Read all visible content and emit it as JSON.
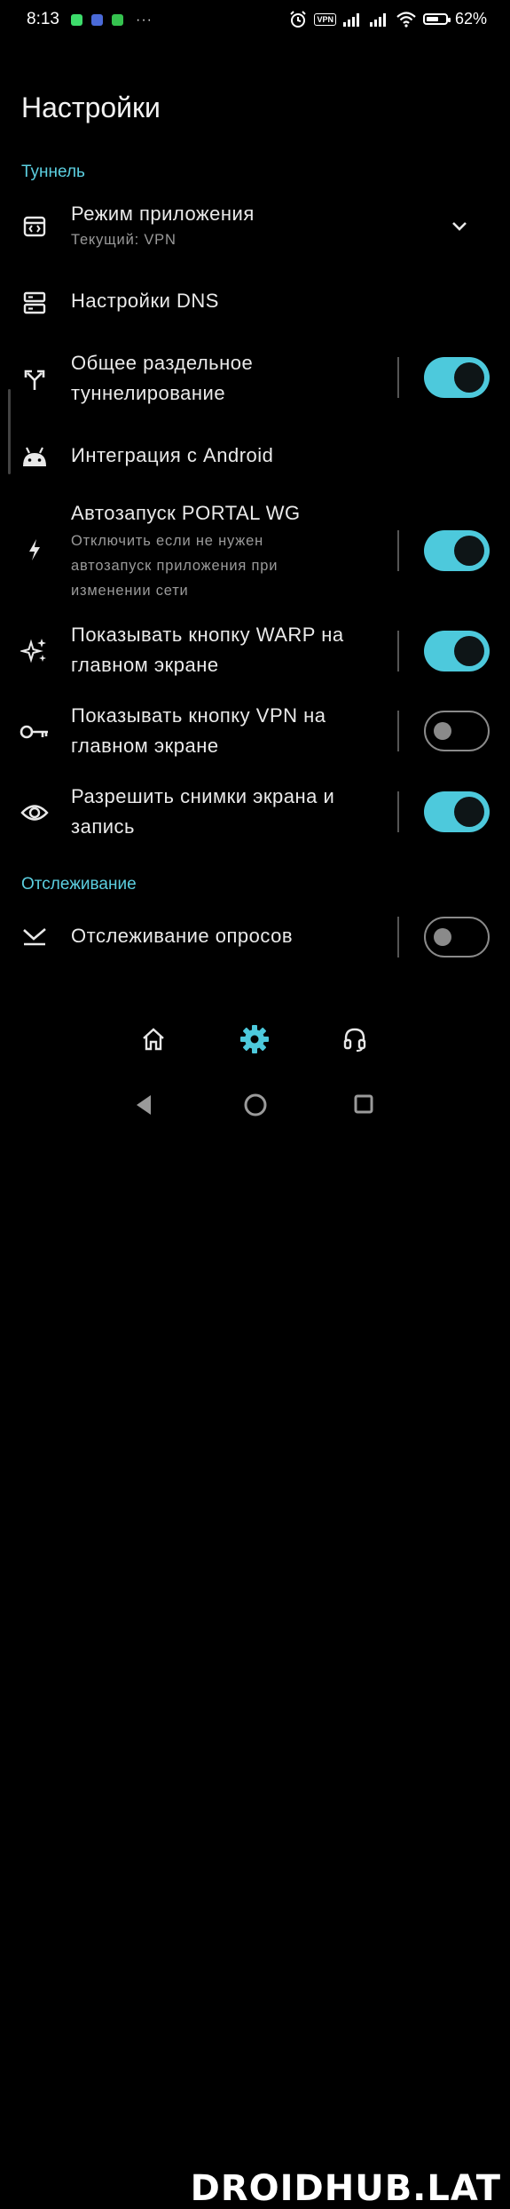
{
  "status_bar": {
    "time": "8:13",
    "vpn_label": "VPN",
    "battery": "62%",
    "battery_level": 0.62
  },
  "page_title": "Настройки",
  "sections": {
    "tunnel": "Туннель",
    "tracking": "Отслеживание"
  },
  "settings": {
    "app_mode": {
      "title": "Режим приложения",
      "subtitle": "Текущий: VPN",
      "icon": "app-window-icon"
    },
    "dns": {
      "title": "Настройки DNS",
      "icon": "dns-server-icon"
    },
    "split_tunnel": {
      "title": "Общее раздельное туннелирование",
      "enabled": true,
      "icon": "split-arrow-icon"
    },
    "android_integration": {
      "title": "Интеграция с Android",
      "icon": "android-icon"
    },
    "autostart": {
      "title": "Автозапуск PORTAL WG",
      "subtitle": "Отключить если не нужен автозапуск приложения при изменении сети",
      "enabled": true,
      "icon": "lightning-icon"
    },
    "warp_button": {
      "title": "Показывать кнопку WARP на главном экране",
      "enabled": true,
      "icon": "sparkles-icon"
    },
    "vpn_button": {
      "title": "Показывать кнопку VPN на главном экране",
      "enabled": false,
      "icon": "key-icon"
    },
    "screenshots": {
      "title": "Разрешить снимки экрана и запись",
      "enabled": true,
      "icon": "eye-icon"
    },
    "poll_tracking": {
      "title": "Отслеживание опросов",
      "enabled": false,
      "icon": "poll-icon"
    }
  },
  "bottom_nav": [
    {
      "name": "home",
      "icon": "home-icon",
      "active": false
    },
    {
      "name": "settings",
      "icon": "gear-icon",
      "active": true
    },
    {
      "name": "support",
      "icon": "headset-icon",
      "active": false
    }
  ],
  "watermark": "DROIDHUB.LAT",
  "colors": {
    "accent": "#5ccfe0",
    "toggle_on": "#4dc9dc",
    "background": "#000000"
  }
}
